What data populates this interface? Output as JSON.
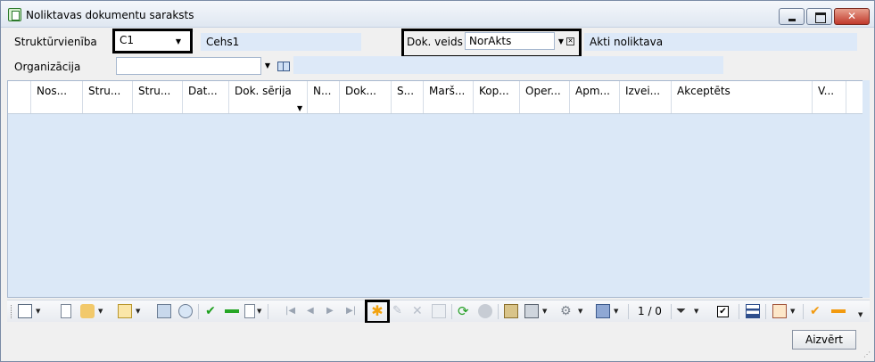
{
  "window": {
    "title": "Noliktavas dokumentu saraksts"
  },
  "filters": {
    "struct_label": "Struktūrvienība",
    "struct_value": "C1",
    "struct_name": "Cehs1",
    "doc_type_label": "Dok. veids",
    "doc_type_value": "NorAkts",
    "doc_type_name": "Akti noliktava",
    "org_label": "Organizācija",
    "org_value": "",
    "org_name": ""
  },
  "grid": {
    "columns": [
      "Nos...",
      "Stru...",
      "Stru...",
      "Dat...",
      "Dok. sērija",
      "N...",
      "Dok...",
      "S...",
      "Marš...",
      "Kop...",
      "Oper...",
      "Apm...",
      "Izvei...",
      "Akceptēts",
      "V..."
    ]
  },
  "toolbar": {
    "page_count": "1 / 0"
  },
  "footer": {
    "close_label": "Aizvērt"
  },
  "colors": {
    "accent_highlight": "#000000",
    "grid_bg": "#dbe8f7",
    "readonly_bg": "#dde9f8"
  }
}
